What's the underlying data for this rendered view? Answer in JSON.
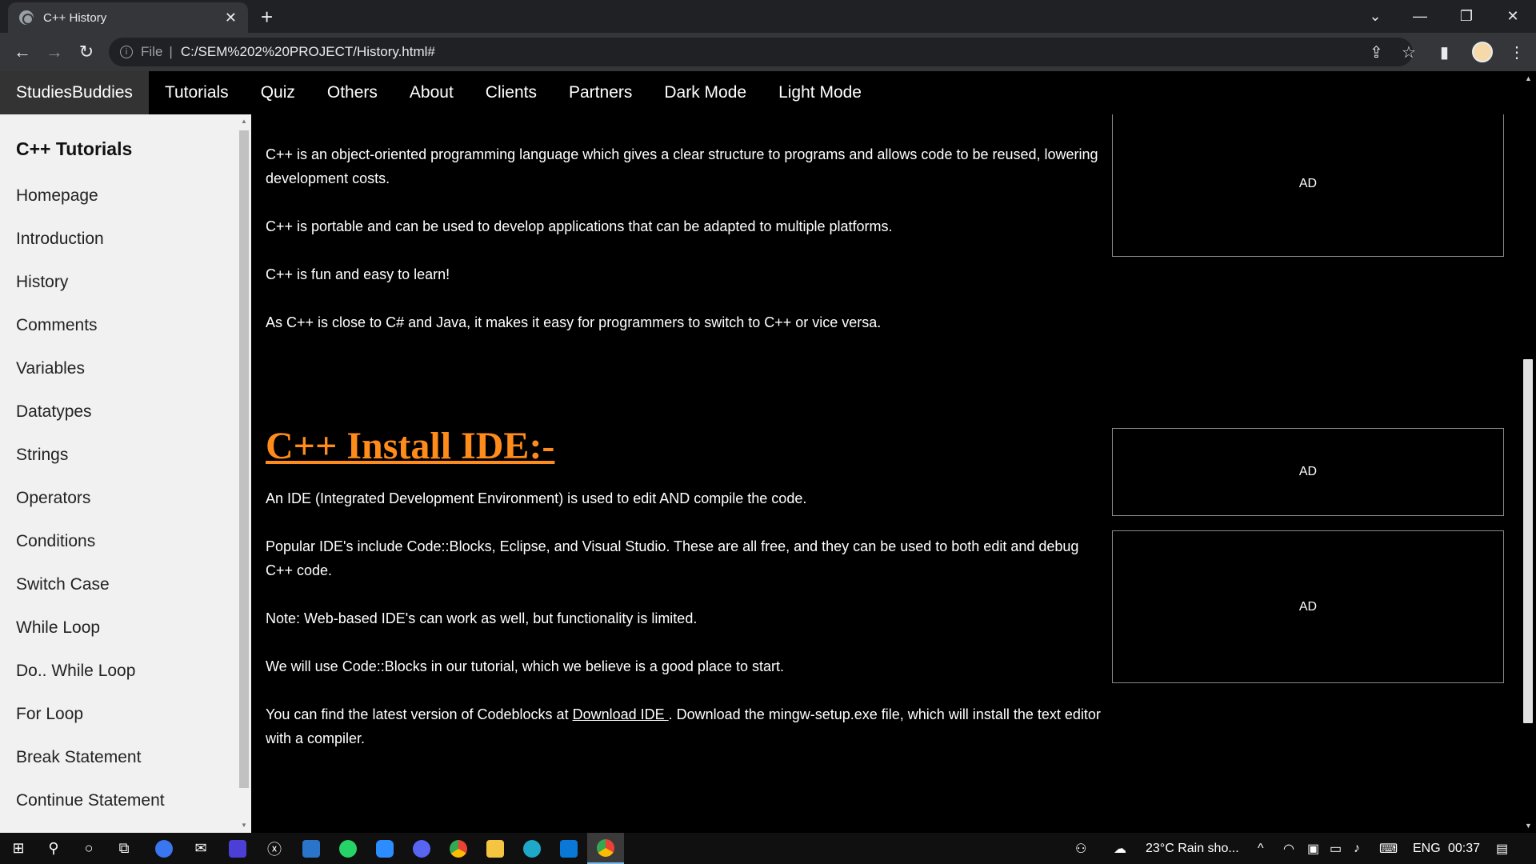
{
  "browser": {
    "tab_title": "C++ History",
    "close_glyph": "✕",
    "new_tab_glyph": "+",
    "file_label": "File",
    "url": "C:/SEM%202%20PROJECT/History.html#"
  },
  "site": {
    "brand": "StudiesBuddies",
    "nav": [
      "Tutorials",
      "Quiz",
      "Others",
      "About",
      "Clients",
      "Partners",
      "Dark Mode",
      "Light Mode"
    ]
  },
  "sidebar": {
    "heading": "C++ Tutorials",
    "items": [
      "Homepage",
      "Introduction",
      "History",
      "Comments",
      "Variables",
      "Datatypes",
      "Strings",
      "Operators",
      "Conditions",
      "Switch Case",
      "While Loop",
      "Do.. While Loop",
      "For Loop",
      "Break Statement",
      "Continue Statement"
    ]
  },
  "content": {
    "intro": [
      "C++ is an object-oriented programming language which gives a clear structure to programs and allows code to be reused, lowering development costs.",
      "C++ is portable and can be used to develop applications that can be adapted to multiple platforms.",
      "C++ is fun and easy to learn!",
      "As C++ is close to C# and Java, it makes it easy for programmers to switch to C++ or vice versa."
    ],
    "heading": "C++ Install IDE:-",
    "ide": [
      "An IDE (Integrated Development Environment) is used to edit AND compile the code.",
      "Popular IDE's include Code::Blocks, Eclipse, and Visual Studio. These are all free, and they can be used to both edit and debug C++ code.",
      "Note: Web-based IDE's can work as well, but functionality is limited.",
      "We will use Code::Blocks in our tutorial, which we believe is a good place to start."
    ],
    "last_before": "You can find the latest version of Codeblocks at ",
    "link_text": "Download IDE ",
    "last_after": ". Download the mingw-setup.exe file, which will install the text editor with a compiler."
  },
  "ads": [
    "AD",
    "AD",
    "AD"
  ],
  "taskbar": {
    "weather": "23°C  Rain sho...",
    "lang": "ENG",
    "time": "00:37"
  }
}
